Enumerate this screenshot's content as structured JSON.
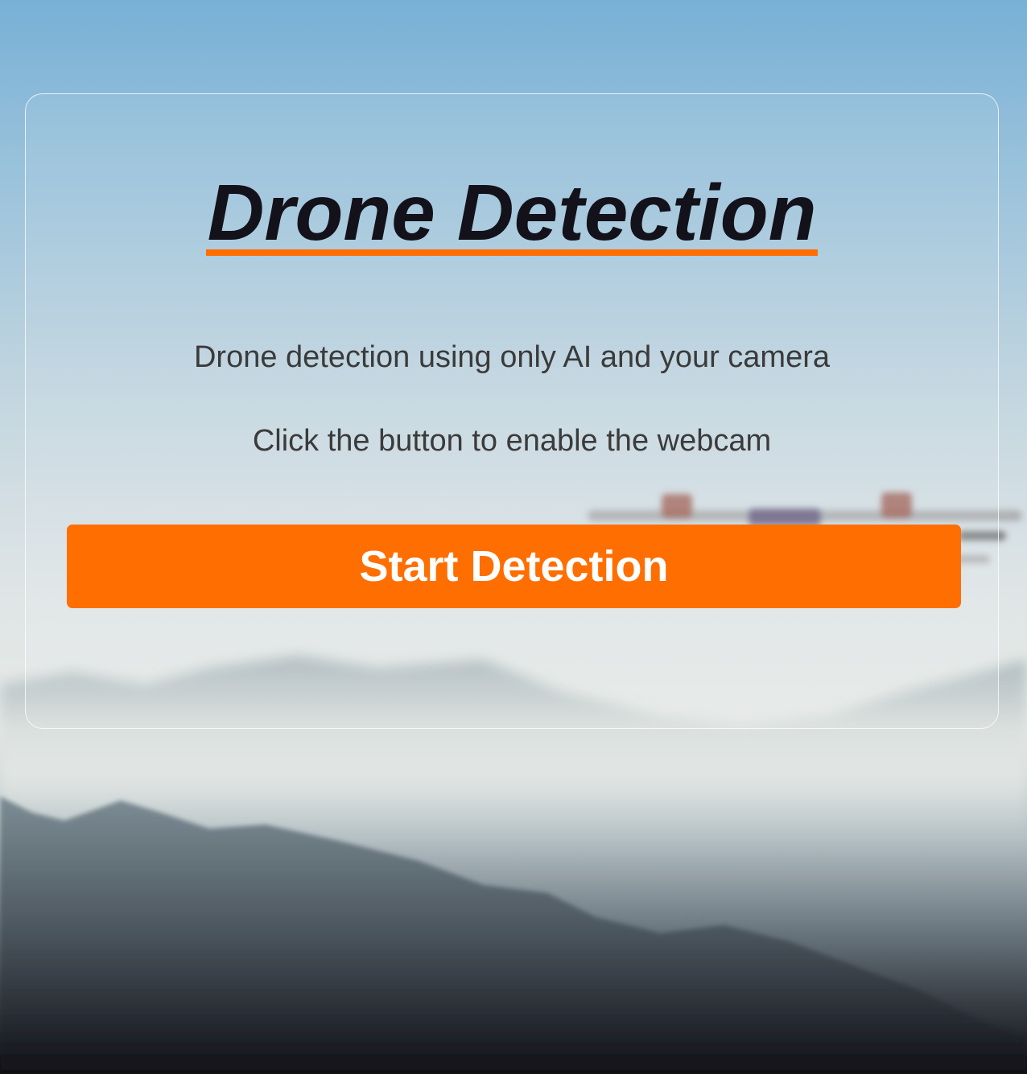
{
  "page": {
    "title": "Drone Detection",
    "subtitle": "Drone detection using only AI and your camera",
    "instruction": "Click the button to enable the webcam",
    "start_button_label": "Start Detection"
  },
  "colors": {
    "accent": "#ff6e00",
    "title_text": "#13111a",
    "body_text": "#3b3b3b",
    "button_text": "#ffffff"
  },
  "icons": {
    "background": "mountain-sky-drone-photo"
  }
}
